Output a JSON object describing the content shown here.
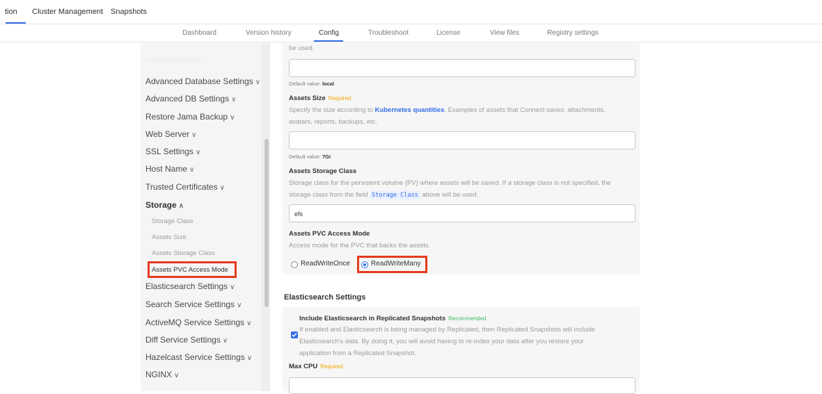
{
  "topnav": {
    "tabs": [
      {
        "label": "tion"
      },
      {
        "label": "Cluster Management"
      },
      {
        "label": "Snapshots"
      }
    ]
  },
  "subnav": {
    "tabs": [
      {
        "label": "Dashboard"
      },
      {
        "label": "Version history"
      },
      {
        "label": "Config"
      },
      {
        "label": "Troubleshoot"
      },
      {
        "label": "License"
      },
      {
        "label": "View files"
      },
      {
        "label": "Registry settings"
      }
    ],
    "active": "Config"
  },
  "sidebar": {
    "items": [
      {
        "label": "Advanced Database Settings"
      },
      {
        "label": "Advanced DB Settings"
      },
      {
        "label": "Restore Jama Backup"
      },
      {
        "label": "Web Server"
      },
      {
        "label": "SSL Settings"
      },
      {
        "label": "Host Name"
      },
      {
        "label": "Trusted Certificates"
      },
      {
        "label": "Storage"
      },
      {
        "label": "Elasticsearch Settings"
      },
      {
        "label": "Search Service Settings"
      },
      {
        "label": "ActiveMQ Service Settings"
      },
      {
        "label": "Diff Service Settings"
      },
      {
        "label": "Hazelcast Service Settings"
      },
      {
        "label": "NGINX"
      }
    ],
    "storage_subitems": [
      {
        "label": "Storage Class"
      },
      {
        "label": "Assets Size"
      },
      {
        "label": "Assets Storage Class"
      },
      {
        "label": "Assets PVC Access Mode"
      }
    ]
  },
  "config": {
    "top_fragment": "be used.",
    "storage_class_default_prefix": "Default value:",
    "storage_class_default_value": "local",
    "assets_size": {
      "label": "Assets Size",
      "badge": "Required",
      "desc_prefix": "Specify the size according to",
      "desc_link": "Kubernetes quantities",
      "desc_suffix": ". Examples of assets that Connect saves: attachments,",
      "desc_line2": "avatars, reports, backups, etc.",
      "input_value": "",
      "default_prefix": "Default value:",
      "default_value": "7Gi"
    },
    "assets_storage_class": {
      "label": "Assets Storage Class",
      "desc_line1": "Storage class for the persistent volume (PV) where assets will be saved. If a storage class is not specified, the",
      "desc_line2_prefix": "storage class from the field",
      "desc_code": "Storage Class",
      "desc_line2_suffix": "above will be used.",
      "input_value": "efs"
    },
    "assets_pvc_access_mode": {
      "label": "Assets PVC Access Mode",
      "desc": "Access mode for the PVC that backs the assets.",
      "options": [
        {
          "label": "ReadWriteOnce",
          "checked": false
        },
        {
          "label": "ReadWriteMany",
          "checked": true
        }
      ]
    }
  },
  "elasticsearch": {
    "title": "Elasticsearch Settings",
    "include_label": "Include Elasticsearch in Replicated Snapshots",
    "include_badge": "Recommended",
    "include_checked": true,
    "include_desc_line1": "If enabled and Elasticsearch is being managed by Replicated, then Replicated Snapshots will include",
    "include_desc_line2": "Elasticsearch's data. By doing it, you will avoid having to re-index your data after you restore your",
    "include_desc_line3": "application from a Replicated Snapshot.",
    "max_cpu_label": "Max CPU",
    "max_cpu_badge": "Required"
  },
  "colors": {
    "accent": "#326de6",
    "highlight": "#e53b1f",
    "required": "#f0a500",
    "recommended": "#44bb66"
  }
}
